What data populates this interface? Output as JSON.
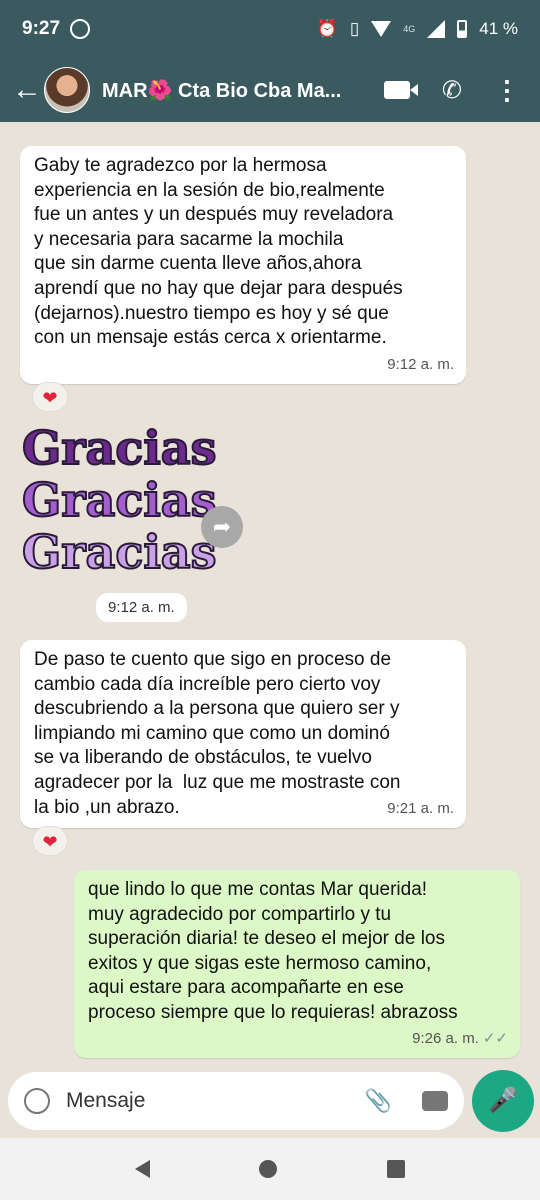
{
  "status": {
    "time": "9:27",
    "network": "4G",
    "battery": "41 %"
  },
  "header": {
    "title": "MAR🌺 Cta Bio Cba Ma..."
  },
  "messages": [
    {
      "dir": "in",
      "text": "Gaby te agradezco por la hermosa\nexperiencia en la sesión de bio,realmente\nfue un antes y un después muy reveladora\ny necesaria para sacarme la mochila\nque sin darme cuenta lleve años,ahora\naprendí que no hay que dejar para después\n(dejarnos).nuestro tiempo es hoy y sé que\ncon un mensaje estás cerca x orientarme.",
      "time": "9:12 a. m.",
      "reaction": "❤"
    },
    {
      "dir": "in",
      "text": "De paso te cuento que sigo en proceso de\ncambio cada día increíble pero cierto voy\ndescubriendo a la persona que quiero ser y\nlimpiando mi camino que como un dominó\nse va liberando de obstáculos, te vuelvo\nagradecer por la  luz que me mostraste con\nla bio ,un abrazo.",
      "time": "9:21 a. m.",
      "reaction": "❤"
    },
    {
      "dir": "out",
      "text": "que lindo lo que me contas Mar querida!\nmuy agradecido por compartirlo y tu\nsuperación diaria! te deseo el mejor de los\nexitos y que sigas este hermoso camino,\naqui estare para acompañarte en ese\nproceso siempre que lo requieras! abrazoss",
      "time": "9:26 a. m.",
      "ticks": "✓✓"
    }
  ],
  "sticker": {
    "lines": [
      "Gracias",
      "Gracias",
      "Gracias"
    ],
    "time": "9:12 a. m."
  },
  "composer": {
    "placeholder": "Mensaje"
  },
  "icons": {
    "back": "back-arrow-icon",
    "video": "video-call-icon",
    "call": "phone-icon",
    "menu": "more-vert-icon",
    "emoji": "emoji-icon",
    "attach": "paperclip-icon",
    "camera": "camera-icon",
    "mic": "mic-icon",
    "forward": "forward-icon"
  }
}
